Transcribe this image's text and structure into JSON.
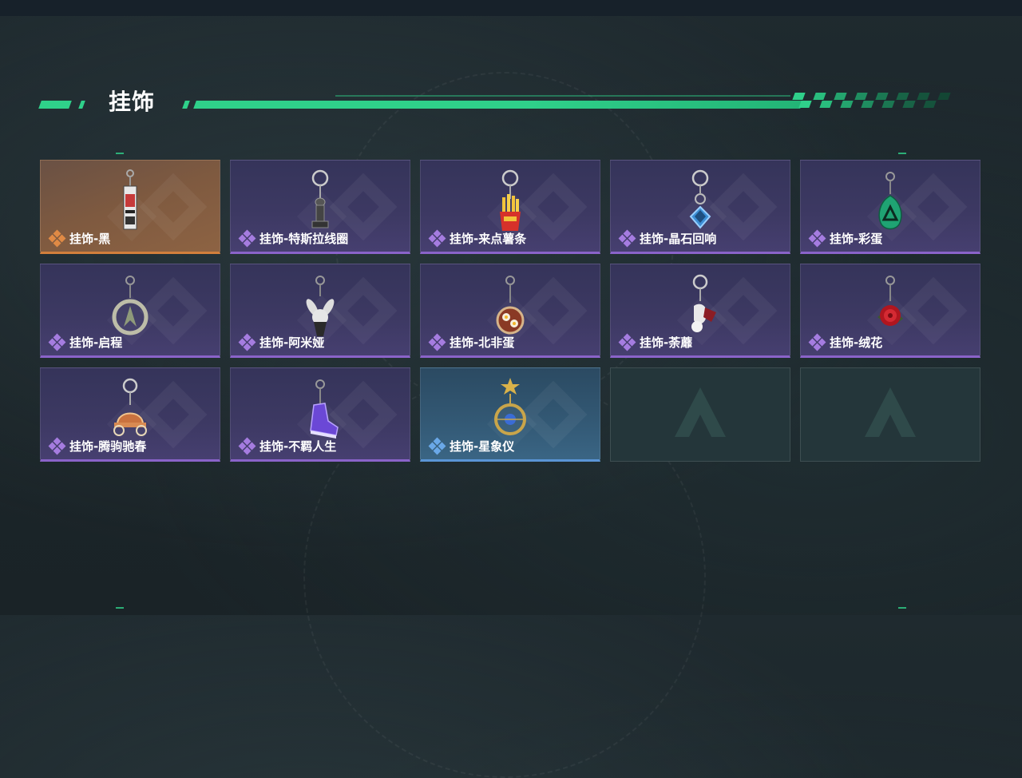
{
  "section": {
    "title": "挂饰"
  },
  "colors": {
    "accent": "#2fd08a",
    "rarity_purple": "#8a63c9",
    "rarity_orange": "#d27f3c",
    "rarity_blue": "#5a95d6"
  },
  "items": [
    {
      "name": "挂饰-黑",
      "rarity": "orange",
      "icon": "black-tag-pendant-icon"
    },
    {
      "name": "挂饰-特斯拉线圈",
      "rarity": "purple",
      "icon": "tesla-coil-pendant-icon"
    },
    {
      "name": "挂饰-来点薯条",
      "rarity": "purple",
      "icon": "french-fries-pendant-icon"
    },
    {
      "name": "挂饰-晶石回响",
      "rarity": "purple",
      "icon": "crystal-pendant-icon"
    },
    {
      "name": "挂饰-彩蛋",
      "rarity": "purple",
      "icon": "easter-egg-pendant-icon"
    },
    {
      "name": "挂饰-启程",
      "rarity": "purple",
      "icon": "compass-ring-pendant-icon"
    },
    {
      "name": "挂饰-阿米娅",
      "rarity": "purple",
      "icon": "bunny-doll-pendant-icon"
    },
    {
      "name": "挂饰-北非蛋",
      "rarity": "purple",
      "icon": "shakshuka-pendant-icon"
    },
    {
      "name": "挂饰-荼蘼",
      "rarity": "purple",
      "icon": "flower-figure-pendant-icon"
    },
    {
      "name": "挂饰-绒花",
      "rarity": "purple",
      "icon": "red-rose-pendant-icon"
    },
    {
      "name": "挂饰-腾驹驰春",
      "rarity": "purple",
      "icon": "carriage-pendant-icon"
    },
    {
      "name": "挂饰-不羁人生",
      "rarity": "purple",
      "icon": "sneaker-pendant-icon"
    },
    {
      "name": "挂饰-星象仪",
      "rarity": "blue",
      "icon": "astrolabe-pendant-icon"
    },
    {
      "name": "",
      "rarity": "empty",
      "icon": "game-logo-icon"
    },
    {
      "name": "",
      "rarity": "empty",
      "icon": "game-logo-icon"
    }
  ]
}
